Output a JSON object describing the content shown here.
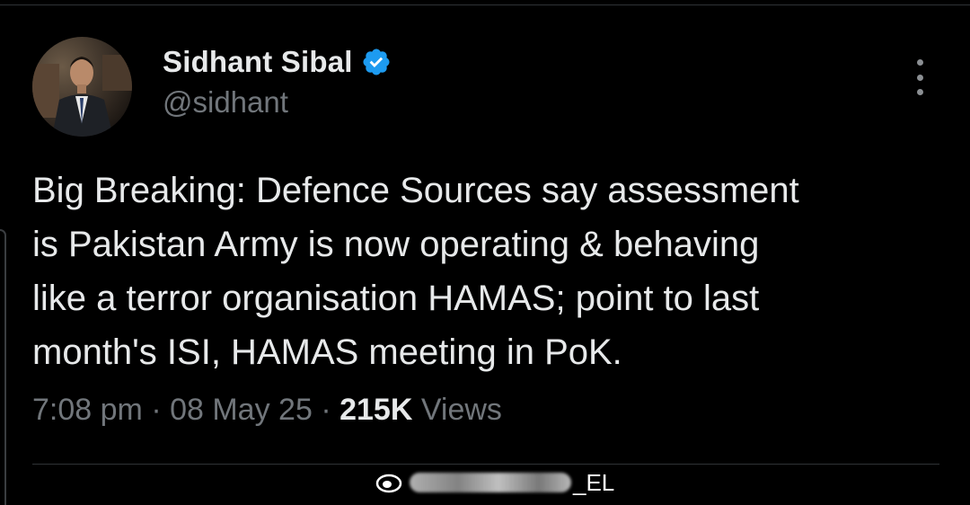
{
  "tweet": {
    "author": {
      "name": "Sidhant Sibal",
      "handle": "@sidhant",
      "verified": true,
      "avatar_icon": "profile-photo"
    },
    "text_lines": [
      "Big Breaking: Defence Sources say assessment",
      "is Pakistan Army is now operating & behaving",
      "like a terror organisation HAMAS; point to last",
      "month's ISI, HAMAS meeting in PoK."
    ],
    "meta": {
      "time": "7:08 pm",
      "separator": "·",
      "date": "08 May 25",
      "views_count": "215K",
      "views_label": "Views"
    },
    "more_icon": "more-options-icon"
  },
  "watermark": {
    "text": "_EL"
  },
  "colors": {
    "background": "#000000",
    "primary_text": "#e7e9ea",
    "secondary_text": "#71767b",
    "verified_badge": "#1d9bf0",
    "divider": "#2f3336"
  }
}
